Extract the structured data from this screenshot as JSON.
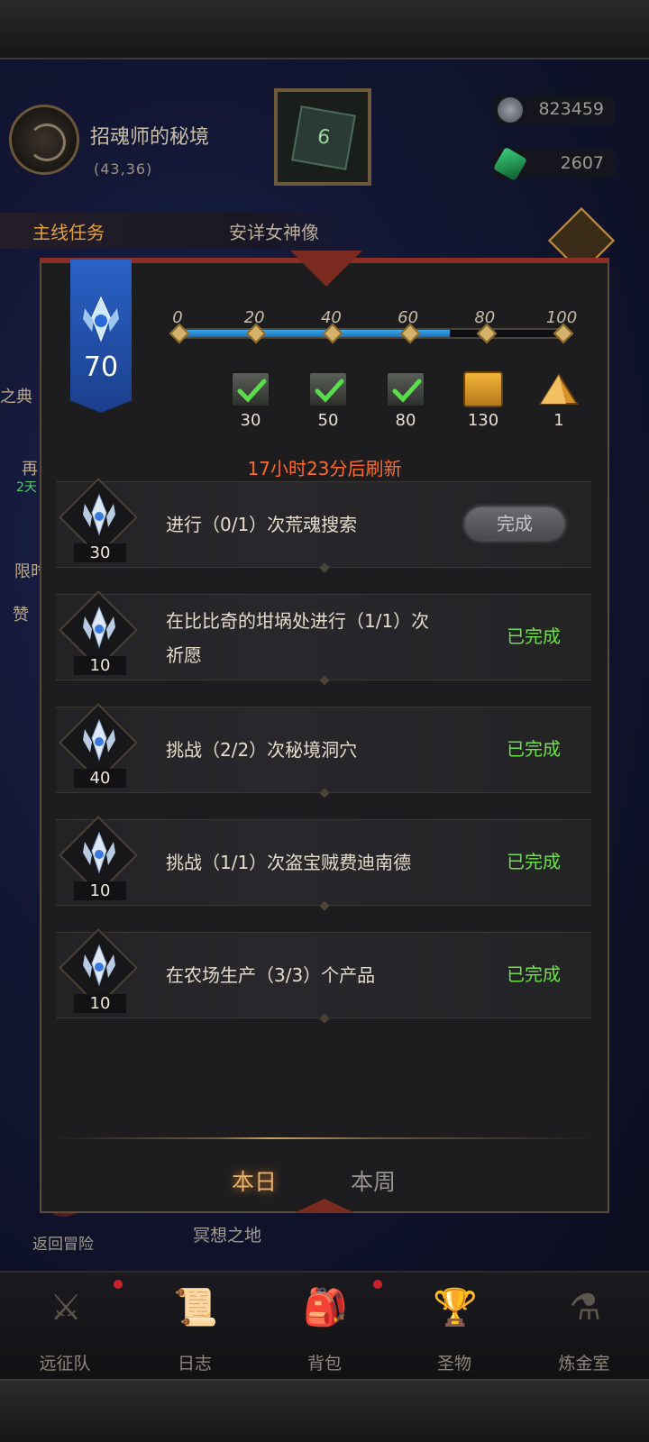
{
  "location": {
    "name": "招魂师的秘境",
    "coords": "(43,36)"
  },
  "resources": [
    {
      "icon": "silver-coin-icon",
      "value": "823459"
    },
    {
      "icon": "green-gem-icon",
      "value": "2607"
    }
  ],
  "main_quest": {
    "label": "主线任务",
    "target": "安详女神像"
  },
  "side_labels": {
    "codex": "之典",
    "limited": "限时",
    "praise": "赞",
    "re": "再",
    "green_note": "2天"
  },
  "scene_labels": {
    "return": "返回冒险",
    "meditate": "冥想之地"
  },
  "bottom_nav": [
    {
      "label": "远征队",
      "icon": "viking-helmet-icon",
      "dot": true
    },
    {
      "label": "日志",
      "icon": "scroll-icon",
      "dot": false
    },
    {
      "label": "背包",
      "icon": "backpack-icon",
      "dot": true
    },
    {
      "label": "圣物",
      "icon": "chalice-icon",
      "dot": false
    },
    {
      "label": "炼金室",
      "icon": "alchemy-icon",
      "dot": false
    }
  ],
  "activity": {
    "level": "70",
    "progress": {
      "value": 70,
      "max": 100,
      "ticks": [
        "0",
        "20",
        "40",
        "60",
        "80",
        "100"
      ]
    },
    "rewards": [
      {
        "icon": "silver-chest-icon",
        "count": "30",
        "claimed": true
      },
      {
        "icon": "silver-chest-icon",
        "count": "50",
        "claimed": true
      },
      {
        "icon": "silver-chest-icon",
        "count": "80",
        "claimed": true
      },
      {
        "icon": "gold-chest-icon",
        "count": "130",
        "claimed": false
      },
      {
        "icon": "gold-pyramid-icon",
        "count": "1",
        "claimed": false
      }
    ],
    "refresh_text": "17小时23分后刷新",
    "tasks": [
      {
        "points": "30",
        "text": "进行（0/1）次荒魂搜索",
        "text2": "",
        "status": "完成",
        "state": "claimable"
      },
      {
        "points": "10",
        "text": "在比比奇的坩埚处进行（1/1）次",
        "text2": "祈愿",
        "status": "已完成",
        "state": "done"
      },
      {
        "points": "40",
        "text": "挑战（2/2）次秘境洞穴",
        "text2": "",
        "status": "已完成",
        "state": "done"
      },
      {
        "points": "10",
        "text": "挑战（1/1）次盗宝贼费迪南德",
        "text2": "",
        "status": "已完成",
        "state": "done"
      },
      {
        "points": "10",
        "text": "在农场生产（3/3）个产品",
        "text2": "",
        "status": "已完成",
        "state": "done"
      }
    ],
    "tabs": [
      {
        "label": "本日",
        "active": true
      },
      {
        "label": "本周",
        "active": false
      }
    ]
  },
  "colors": {
    "accent_orange": "#ff6a2a",
    "done_green": "#6ee04a",
    "banner_blue": "#2a62c6"
  }
}
